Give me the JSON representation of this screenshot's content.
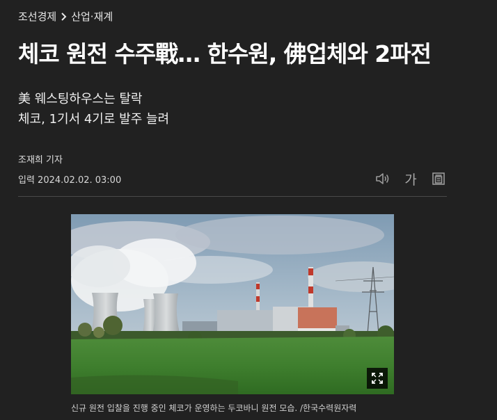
{
  "breadcrumb": {
    "section": "조선경제",
    "subsection": "산업·재계"
  },
  "article": {
    "headline": "체코 원전 수주戰… 한수원, 佛업체와 2파전",
    "subheadline_line1": "美 웨스팅하우스는 탈락",
    "subheadline_line2": "체코, 1기서 4기로 발주 늘려",
    "reporter": "조재희 기자",
    "published": "입력 2024.02.02. 03:00"
  },
  "tools": {
    "font_label": "가",
    "icons": [
      "speaker-icon",
      "font-size-icon",
      "print-icon"
    ]
  },
  "photo": {
    "caption": "신규 원전 입찰을 진행 중인 체코가 운영하는 두코바니 원전 모습. /한국수력원자력",
    "expand_icon": "expand-icon"
  },
  "colors": {
    "background": "#212121",
    "divider": "#4a4a4a",
    "icon_gray": "#9a9a9a"
  }
}
